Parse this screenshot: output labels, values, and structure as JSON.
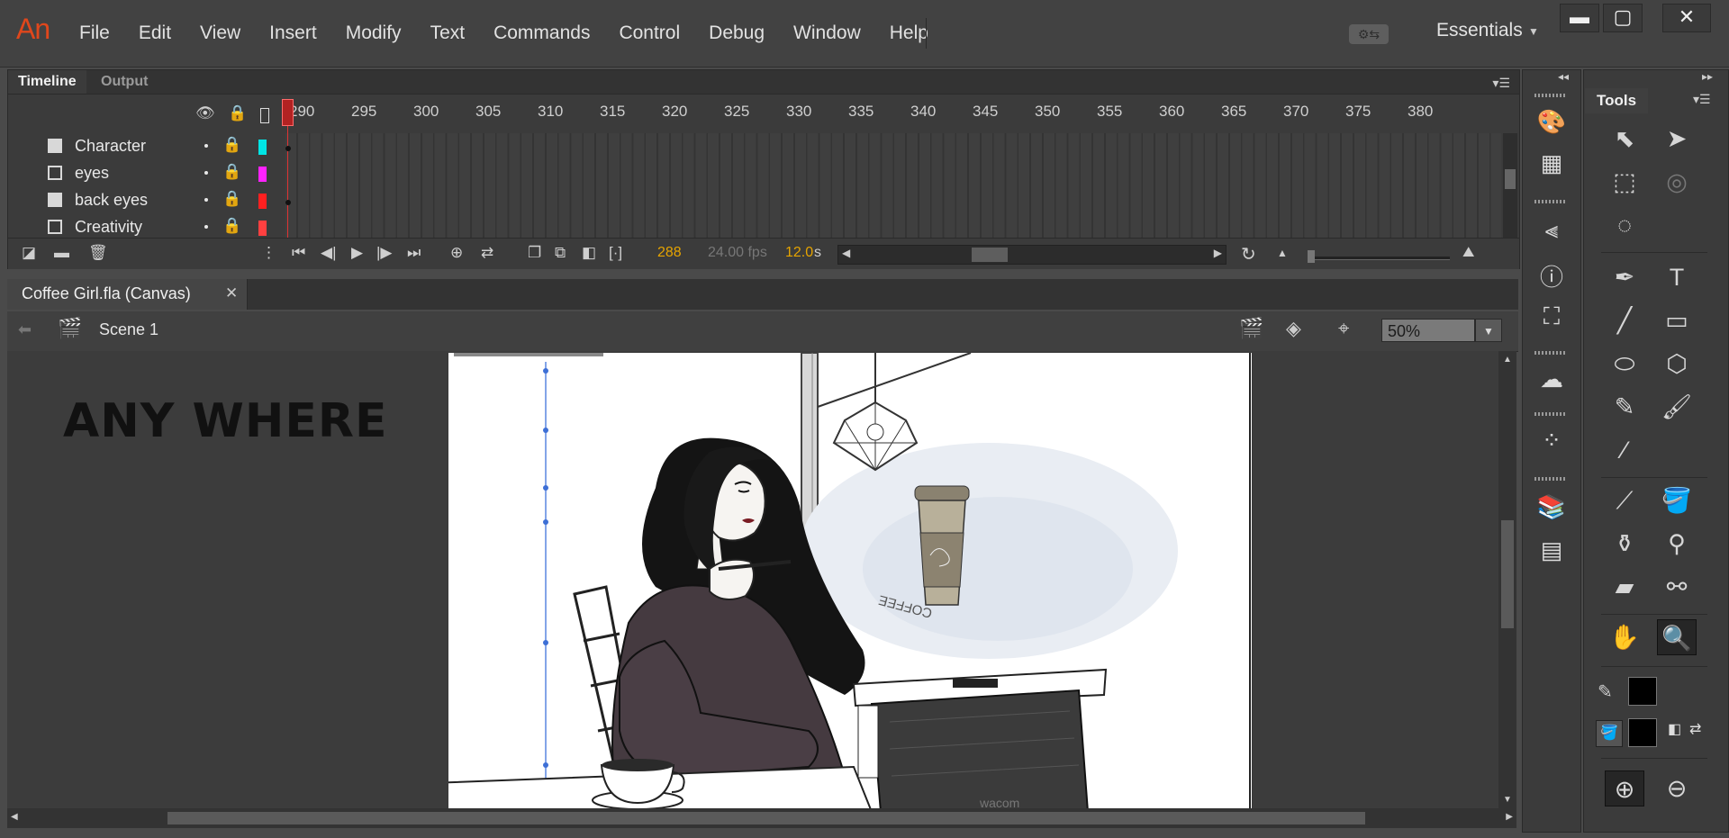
{
  "app": {
    "logo": "An"
  },
  "menu": [
    "File",
    "Edit",
    "View",
    "Insert",
    "Modify",
    "Text",
    "Commands",
    "Control",
    "Debug",
    "Window",
    "Help"
  ],
  "workspace": {
    "label": "Essentials"
  },
  "window_controls": {
    "minimize": "▬",
    "maximize": "▢",
    "close": "✕"
  },
  "timeline": {
    "tabs": [
      "Timeline",
      "Output"
    ],
    "ruler_ticks": [
      "290",
      "295",
      "300",
      "305",
      "310",
      "315",
      "320",
      "325",
      "330",
      "335",
      "340",
      "345",
      "350",
      "355",
      "360",
      "365",
      "370",
      "375",
      "380"
    ],
    "layers": [
      {
        "name": "Character",
        "color": "#00e5e5"
      },
      {
        "name": "eyes",
        "color": "#ff22ff"
      },
      {
        "name": "back eyes",
        "color": "#ff2020"
      },
      {
        "name": "Creativity",
        "color": "#ff4040"
      }
    ],
    "current_frame": "288",
    "fps": "24.00 fps",
    "time": "12.0",
    "time_unit": "s"
  },
  "document": {
    "tab_label": "Coffee Girl.fla (Canvas)",
    "close": "✕",
    "scene": "Scene 1",
    "zoom": "50%"
  },
  "canvas": {
    "title_text": "ANY WHERE",
    "cup_text": "COFFEE",
    "tablet_text": "wacom"
  },
  "tools_panel": {
    "title": "Tools"
  }
}
